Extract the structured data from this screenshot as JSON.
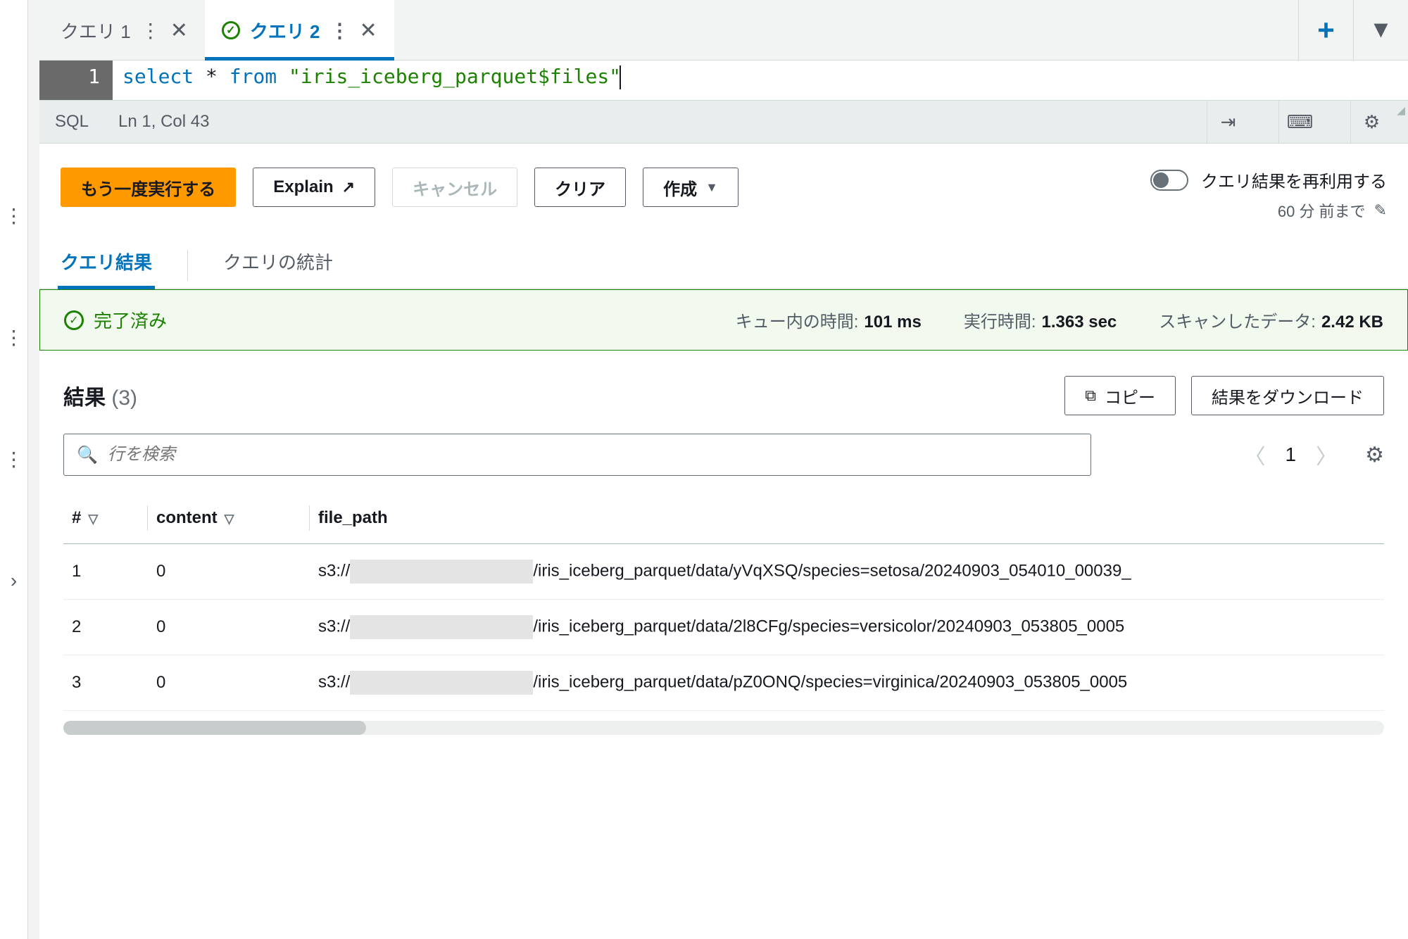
{
  "tabs": [
    {
      "label": "クエリ 1",
      "active": false,
      "hasSuccess": false
    },
    {
      "label": "クエリ 2",
      "active": true,
      "hasSuccess": true
    }
  ],
  "tabbar_icons": {
    "plus": "+",
    "caret": "▼"
  },
  "editor": {
    "line_number": "1",
    "kw_select": "select",
    "star": " * ",
    "kw_from": "from",
    "space": " ",
    "string_literal": "\"iris_iceberg_parquet$files\""
  },
  "statusbar": {
    "lang": "SQL",
    "pos": "Ln 1, Col 43"
  },
  "actions": {
    "run_again": "もう一度実行する",
    "explain": "Explain",
    "cancel": "キャンセル",
    "clear": "クリア",
    "create": "作成",
    "reuse_label": "クエリ結果を再利用する",
    "reuse_sub": "60 分 前まで"
  },
  "result_tabs": {
    "results": "クエリ結果",
    "stats": "クエリの統計"
  },
  "banner": {
    "status": "完了済み",
    "queue_label": "キュー内の時間:",
    "queue_value": "101 ms",
    "run_label": "実行時間:",
    "run_value": "1.363 sec",
    "scan_label": "スキャンしたデータ:",
    "scan_value": "2.42 KB"
  },
  "results_header": {
    "title": "結果",
    "count": "(3)",
    "copy": "コピー",
    "download": "結果をダウンロード"
  },
  "search": {
    "placeholder": "行を検索"
  },
  "pager": {
    "page": "1"
  },
  "table": {
    "columns": {
      "idx": "#",
      "content": "content",
      "file_path": "file_path"
    },
    "rows": [
      {
        "idx": "1",
        "content": "0",
        "prefix": "s3://",
        "suffix": "/iris_iceberg_parquet/data/yVqXSQ/species=setosa/20240903_054010_00039_"
      },
      {
        "idx": "2",
        "content": "0",
        "prefix": "s3://",
        "suffix": "/iris_iceberg_parquet/data/2l8CFg/species=versicolor/20240903_053805_0005"
      },
      {
        "idx": "3",
        "content": "0",
        "prefix": "s3://",
        "suffix": "/iris_iceberg_parquet/data/pZ0ONQ/species=virginica/20240903_053805_0005"
      }
    ]
  }
}
